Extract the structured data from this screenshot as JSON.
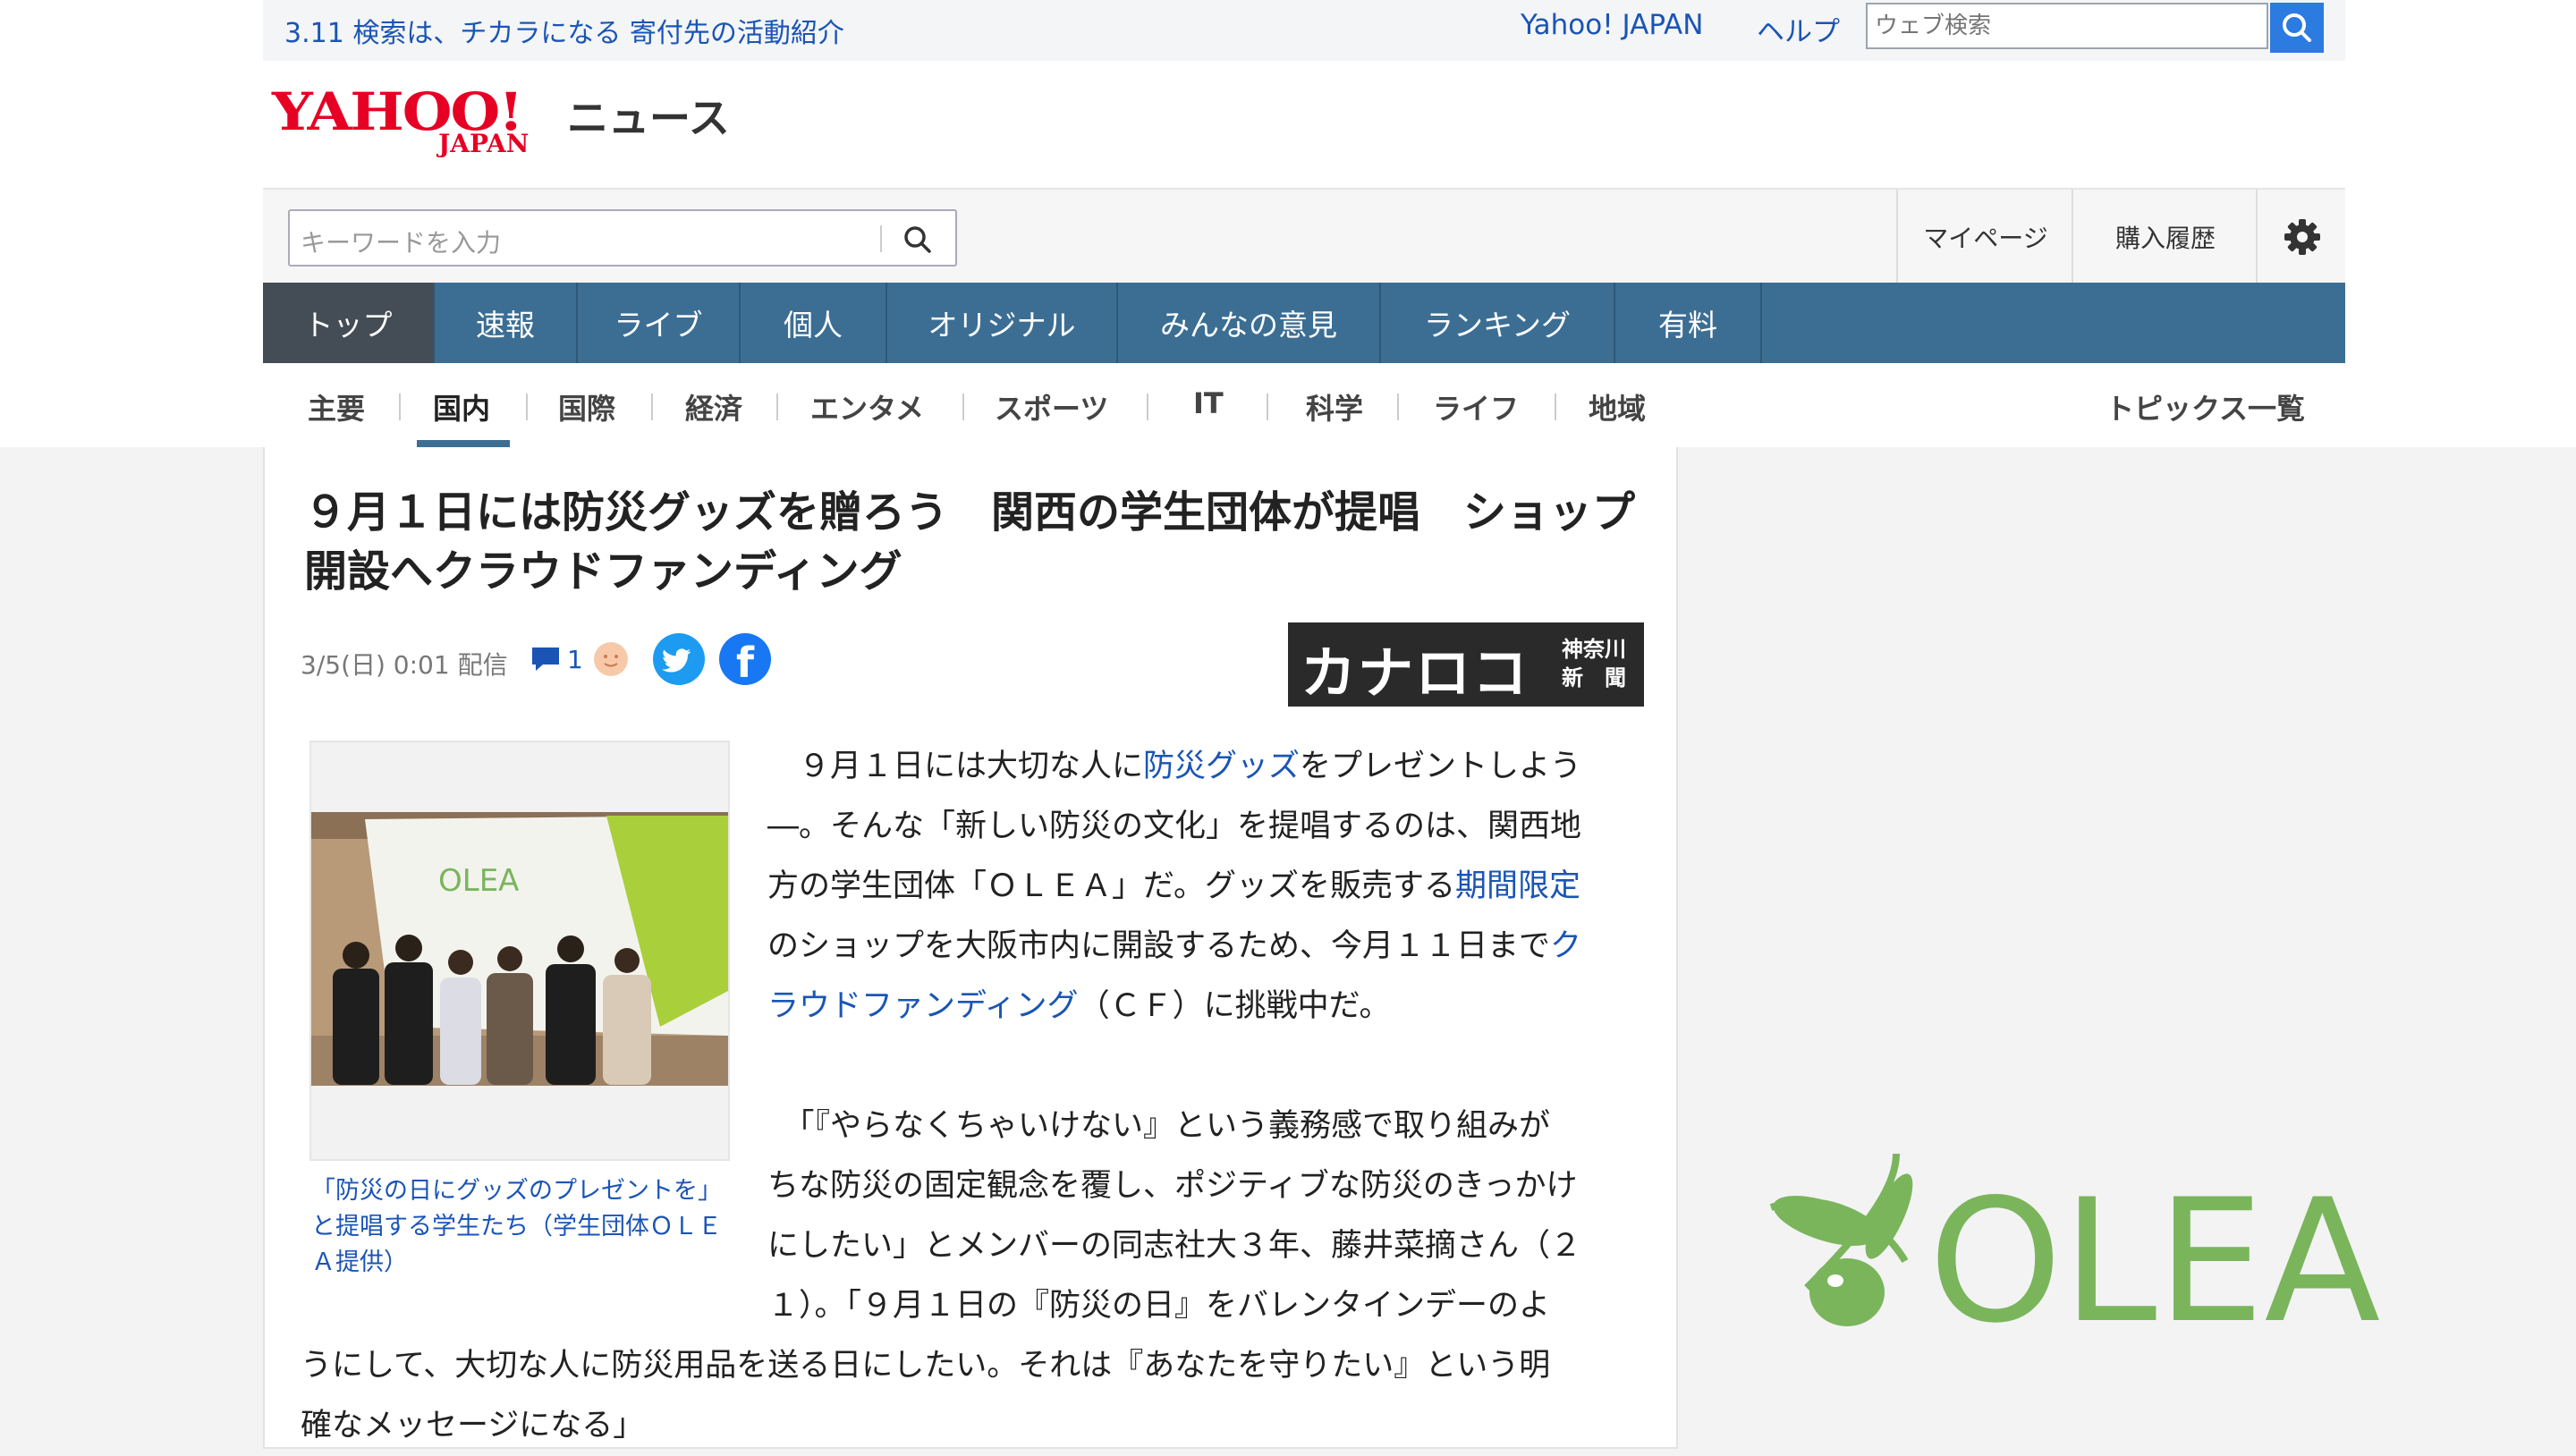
{
  "topbar": {
    "promo": "3.11 検索は、チカラになる 寄付先の活動紹介",
    "yahoo_japan": "Yahoo! JAPAN",
    "help": "ヘルプ",
    "web_search_placeholder": "ウェブ検索"
  },
  "logo": {
    "yahoo": "YAHOO!",
    "japan": "JAPAN",
    "news": "ニュース"
  },
  "search": {
    "placeholder": "キーワードを入力",
    "mypage": "マイページ",
    "history": "購入履歴"
  },
  "nav": {
    "tabs": [
      "トップ",
      "速報",
      "ライブ",
      "個人",
      "オリジナル",
      "みんなの意見",
      "ランキング",
      "有料"
    ],
    "active": "トップ"
  },
  "subnav": {
    "items": [
      "主要",
      "国内",
      "国際",
      "経済",
      "エンタメ",
      "スポーツ",
      "IT",
      "科学",
      "ライフ",
      "地域"
    ],
    "active": "国内",
    "all_topics": "トピックス一覧"
  },
  "article": {
    "title": "９月１日には防災グッズを贈ろう　関西の学生団体が提唱　ショップ開設へクラウドファンディング",
    "date": "3/5(日) 0:01",
    "delivered": "配信",
    "comments": "1",
    "source_big": "カナロコ",
    "source_small_1": "神奈川",
    "source_small_2": "新　聞",
    "photo_brand": "OLEA",
    "caption": "「防災の日にグッズのプレゼントを」と提唱する学生たち（学生団体ＯＬＥＡ提供）",
    "p1": {
      "l1a": "　９月１日には大切な人に",
      "l1link": "防災グッズ",
      "l1b": "をプレゼントしよう",
      "l2": "―。そんな「新しい防災の文化」を提唱するのは、関西地",
      "l3a": "方の学生団体「ＯＬＥＡ」だ。グッズを販売する",
      "l3link": "期間限定",
      "l4a": "のショップを大阪市内に開設するため、今月１１日まで",
      "l4link": "ク",
      "l5link": "ラウドファンディング",
      "l5b": "（ＣＦ）に挑戦中だ。"
    },
    "p2": {
      "l1": "　「『やらなくちゃいけない』という義務感で取り組みが",
      "l2": "ちな防災の固定観念を覆し、ポジティブな防災のきっかけ",
      "l3": "にしたい」とメンバーの同志社大３年、藤井菜摘さん（２",
      "l4": "１）。「９月１日の『防災の日』をバレンタインデーのよ",
      "l5": "うにして、大切な人に防災用品を送る日にしたい。それは『あなたを守りたい』という明",
      "l6": "確なメッセージになる」"
    }
  },
  "side_logo": "OLEA",
  "colors": {
    "link": "#1a55b6",
    "nav": "#3c6e94",
    "nav_active": "#444c55",
    "yahoo_red": "#e60024",
    "olea_green": "#7ab55c"
  }
}
